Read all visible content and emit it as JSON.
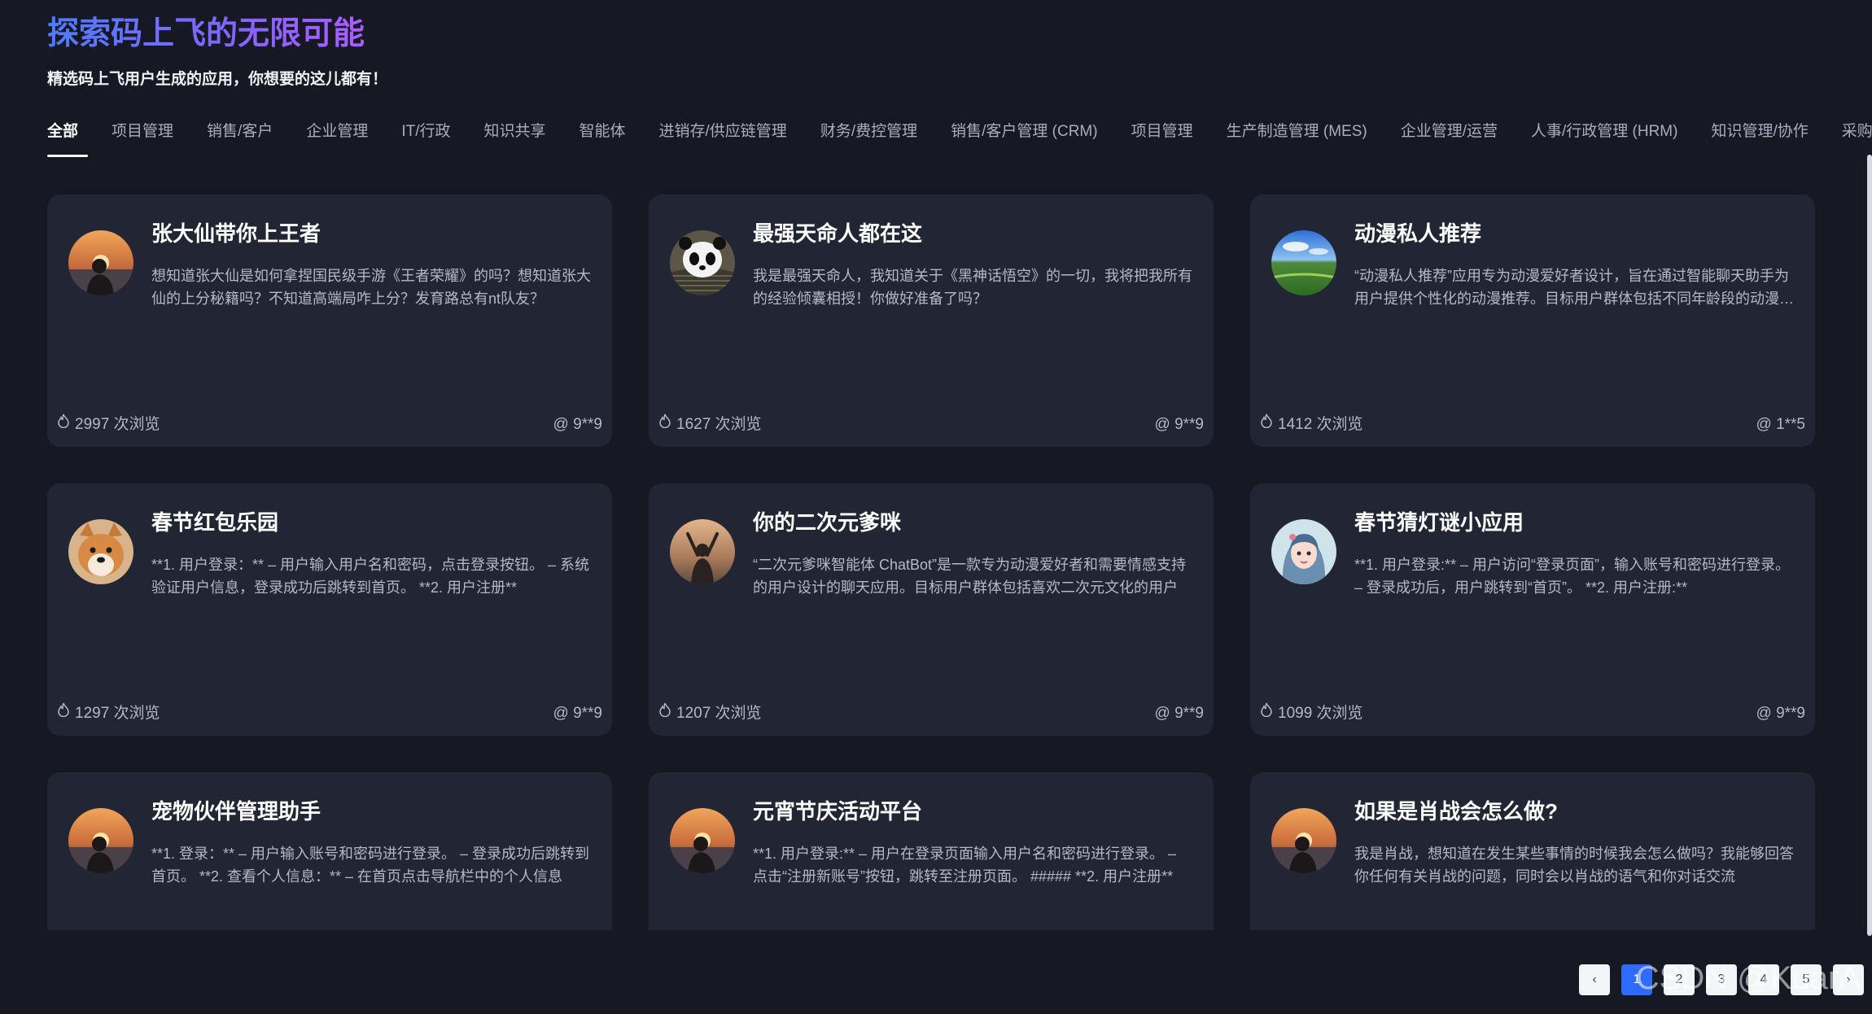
{
  "header": {
    "title": "探索码上飞的无限可能",
    "subtitle": "精选码上飞用户生成的应用，你想要的这儿都有！"
  },
  "tabs": [
    {
      "label": "全部",
      "active": true
    },
    {
      "label": "项目管理"
    },
    {
      "label": "销售/客户"
    },
    {
      "label": "企业管理"
    },
    {
      "label": "IT/行政"
    },
    {
      "label": "知识共享"
    },
    {
      "label": "智能体"
    },
    {
      "label": "进销存/供应链管理"
    },
    {
      "label": "财务/费控管理"
    },
    {
      "label": "销售/客户管理 (CRM)"
    },
    {
      "label": "项目管理"
    },
    {
      "label": "生产制造管理 (MES)"
    },
    {
      "label": "企业管理/运营"
    },
    {
      "label": "人事/行政管理 (HRM)"
    },
    {
      "label": "知识管理/协作"
    },
    {
      "label": "采购管理"
    }
  ],
  "cards": [
    {
      "title": "张大仙带你上王者",
      "desc": "想知道张大仙是如何拿捏国民级手游《王者荣耀》的吗？想知道张大仙的上分秘籍吗？不知道高端局咋上分？发育路总有nt队友？",
      "views": "2997 次浏览",
      "author": "@ 9**9",
      "avatar": "sunset-avatar"
    },
    {
      "title": "最强天命人都在这",
      "desc": "我是最强天命人，我知道关于《黑神话悟空》的一切，我将把我所有的经验倾囊相授！你做好准备了吗？",
      "views": "1627 次浏览",
      "author": "@ 9**9",
      "avatar": "panda-avatar"
    },
    {
      "title": "动漫私人推荐",
      "desc": "“动漫私人推荐”应用专为动漫爱好者设计，旨在通过智能聊天助手为用户提供个性化的动漫推荐。目标用户群体包括不同年龄段的动漫爱好者",
      "views": "1412 次浏览",
      "author": "@ 1**5",
      "avatar": "landscape-avatar"
    },
    {
      "title": "春节红包乐园",
      "desc": "**1. 用户登录：** – 用户输入用户名和密码，点击登录按钮。 – 系统验证用户信息，登录成功后跳转到首页。 **2. 用户注册**",
      "views": "1297 次浏览",
      "author": "@ 9**9",
      "avatar": "dog-avatar"
    },
    {
      "title": "你的二次元爹咪",
      "desc": "“二次元爹咪智能体 ChatBot”是一款专为动漫爱好者和需要情感支持的用户设计的聊天应用。目标用户群体包括喜欢二次元文化的用户",
      "views": "1207 次浏览",
      "author": "@ 9**9",
      "avatar": "person-avatar"
    },
    {
      "title": "春节猜灯谜小应用",
      "desc": "**1. 用户登录:** – 用户访问“登录页面”，输入账号和密码进行登录。 – 登录成功后，用户跳转到“首页”。 **2. 用户注册:**",
      "views": "1099 次浏览",
      "author": "@ 9**9",
      "avatar": "girl-avatar"
    },
    {
      "title": "宠物伙伴管理助手",
      "desc": "**1. 登录：** – 用户输入账号和密码进行登录。 – 登录成功后跳转到首页。 **2. 查看个人信息：** – 在首页点击导航栏中的个人信息",
      "views": "",
      "author": "",
      "avatar": "sunset-avatar"
    },
    {
      "title": "元宵节庆活动平台",
      "desc": "**1. 用户登录:** – 用户在登录页面输入用户名和密码进行登录。 – 点击“注册新账号”按钮，跳转至注册页面。 ##### **2. 用户注册**",
      "views": "",
      "author": "",
      "avatar": "sunset-avatar"
    },
    {
      "title": "如果是肖战会怎么做?",
      "desc": "我是肖战，想知道在发生某些事情的时候我会怎么做吗？我能够回答你任何有关肖战的问题，同时会以肖战的语气和你对话交流",
      "views": "",
      "author": "",
      "avatar": "sunset-avatar"
    }
  ],
  "pagination": {
    "prev": "‹",
    "pages": [
      "1",
      "2",
      "3",
      "4",
      "5"
    ],
    "next": "›"
  },
  "watermark": "CSDN @KuarA"
}
